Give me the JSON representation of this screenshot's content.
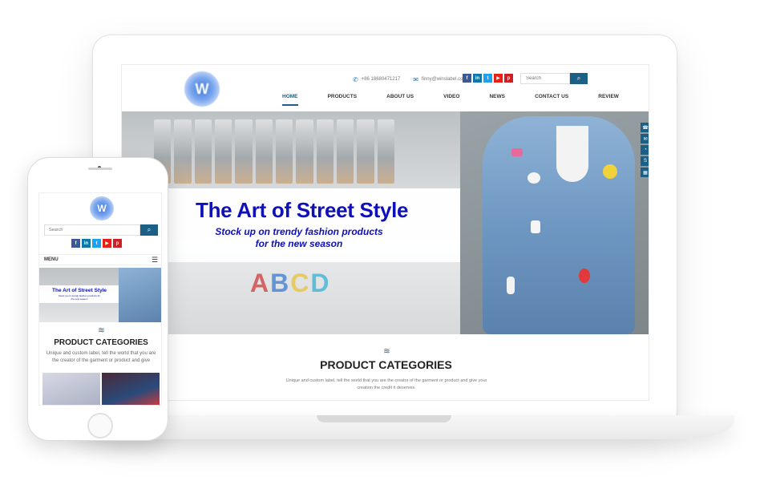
{
  "desktop": {
    "logo_glyph": "W",
    "phone": "+86 18680471217",
    "email": "finny@winslabel.com",
    "search_placeholder": "Search",
    "search_glyph": "⌕",
    "nav": [
      "HOME",
      "PRODUCTS",
      "ABOUT US",
      "VIDEO",
      "NEWS",
      "CONTACT US",
      "REVIEW"
    ],
    "hero": {
      "title": "The Art of Street Style",
      "subtitle_line1": "Stock up on trendy fashion products",
      "subtitle_line2": "for the new season",
      "letters": [
        "A",
        "B",
        "C",
        "D"
      ]
    },
    "categories": {
      "wave": "≋",
      "title": "PRODUCT CATEGORIES",
      "desc": "Unique and custom label, tell the world that you are the creator of the garment or product and give your creation the credit it deserves."
    },
    "side_tools": [
      "☎",
      "✉",
      "◔",
      "S",
      "▦"
    ]
  },
  "social": [
    "f",
    "in",
    "t",
    "▶",
    "p"
  ],
  "mobile": {
    "logo_glyph": "W",
    "search_placeholder": "Search",
    "search_glyph": "⌕",
    "menu_label": "MENU",
    "menu_glyph": "☰",
    "hero": {
      "title": "The Art of Street Style",
      "subtitle": "Stock up on trendy fashion products for the new season"
    },
    "categories": {
      "wave": "≋",
      "title": "PRODUCT CATEGORIES",
      "desc": "Unique and custom label, tell the world that you are the creator of the garment or product and give"
    }
  },
  "icons": {
    "phone": "phone-icon",
    "email": "email-icon",
    "search": "search-icon",
    "menu": "hamburger-menu-icon"
  },
  "colors": {
    "accent": "#1b5f85",
    "hero_text": "#1010b8"
  }
}
